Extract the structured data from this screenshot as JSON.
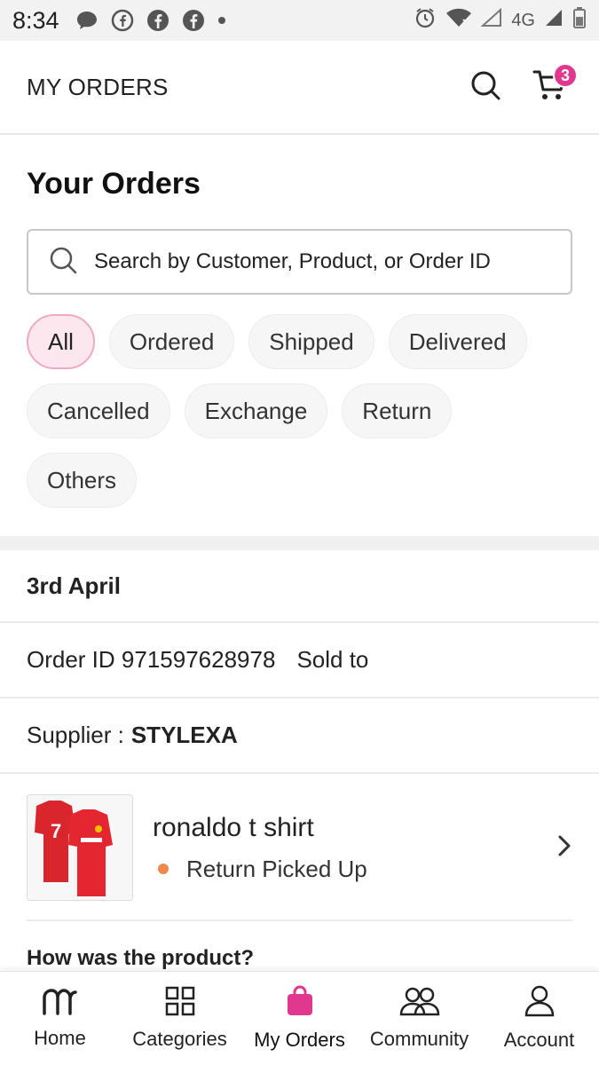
{
  "status_bar": {
    "time": "8:34",
    "network": "4G"
  },
  "header": {
    "title": "MY ORDERS",
    "cart_count": "3"
  },
  "orders": {
    "title": "Your Orders",
    "search_placeholder": "Search by Customer, Product, or Order ID",
    "filters": [
      "All",
      "Ordered",
      "Shipped",
      "Delivered",
      "Cancelled",
      "Exchange",
      "Return",
      "Others"
    ],
    "active_filter": "All"
  },
  "order": {
    "date": "3rd April",
    "order_id": "Order ID 971597628978",
    "sold_to_label": "Sold to",
    "supplier_label": "Supplier :",
    "supplier_name": "STYLEXA",
    "product_name": "ronaldo t shirt",
    "product_status": "Return Picked Up",
    "review_prompt": "How was the product?"
  },
  "bottom_nav": {
    "items": [
      {
        "label": "Home",
        "icon": "home-logo-icon"
      },
      {
        "label": "Categories",
        "icon": "grid-icon"
      },
      {
        "label": "My Orders",
        "icon": "shopping-bag-icon"
      },
      {
        "label": "Community",
        "icon": "community-icon"
      },
      {
        "label": "Account",
        "icon": "account-icon"
      }
    ],
    "active": "My Orders"
  },
  "colors": {
    "accent": "#e0378f",
    "chip_active_bg": "#fde7ef",
    "status_dot": "#f0884d"
  }
}
